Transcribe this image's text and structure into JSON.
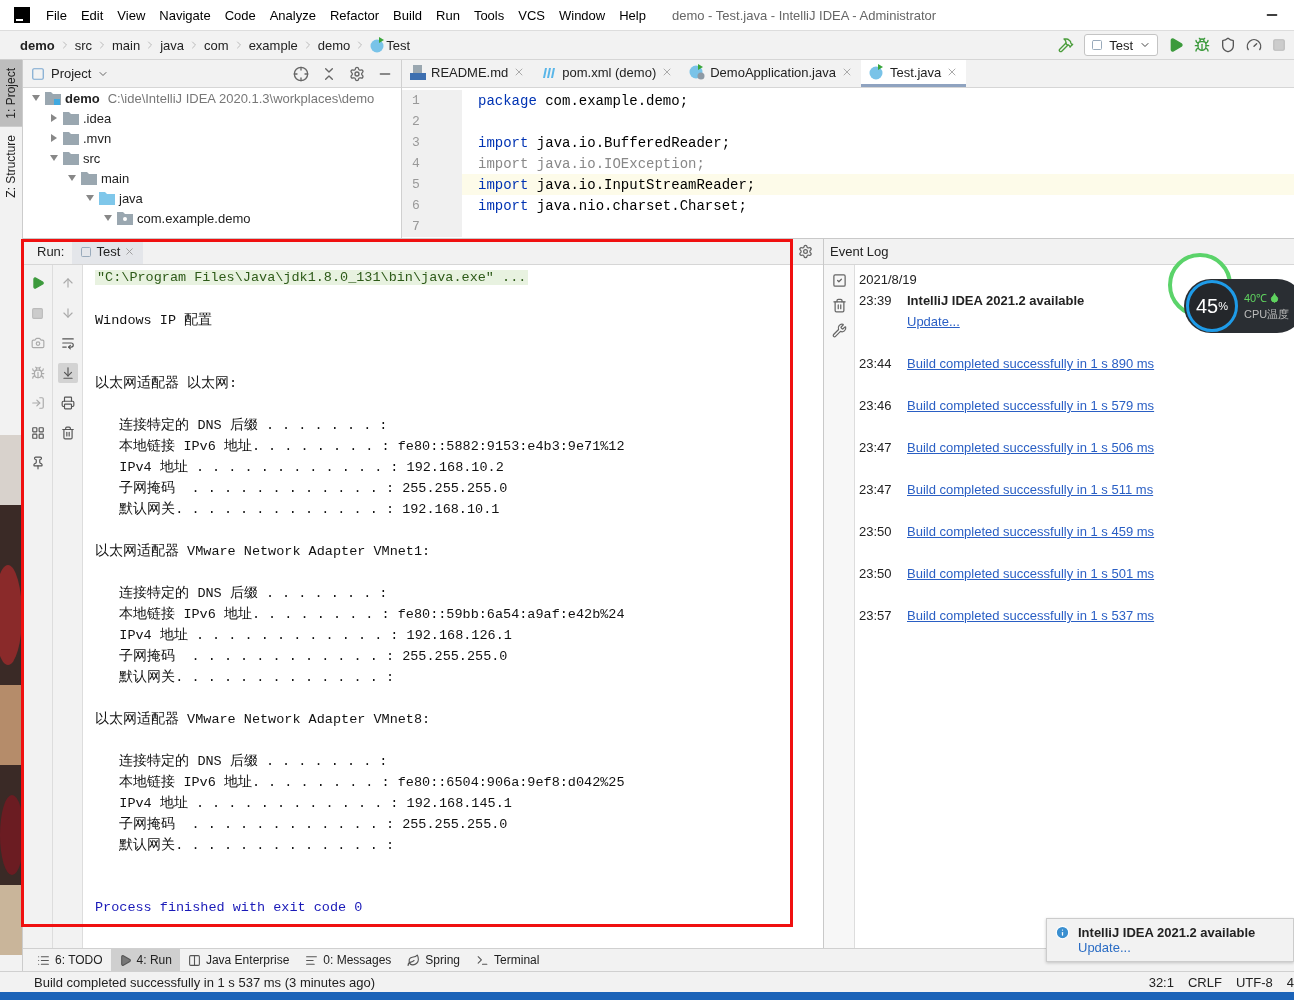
{
  "window": {
    "title": "demo - Test.java - IntelliJ IDEA - Administrator"
  },
  "menu": [
    "File",
    "Edit",
    "View",
    "Navigate",
    "Code",
    "Analyze",
    "Refactor",
    "Build",
    "Run",
    "Tools",
    "VCS",
    "Window",
    "Help"
  ],
  "breadcrumbs": [
    {
      "label": "demo",
      "kind": "project"
    },
    {
      "label": "src",
      "kind": "folder"
    },
    {
      "label": "main",
      "kind": "folder"
    },
    {
      "label": "java",
      "kind": "folder"
    },
    {
      "label": "com",
      "kind": "folder"
    },
    {
      "label": "example",
      "kind": "folder"
    },
    {
      "label": "demo",
      "kind": "folder"
    },
    {
      "label": "Test",
      "kind": "class"
    }
  ],
  "run_config": {
    "label": "Test"
  },
  "side_tabs": [
    {
      "label": "1: Project",
      "selected": true
    },
    {
      "label": "Z: Structure",
      "selected": false
    }
  ],
  "project_panel": {
    "title": "Project",
    "tree": [
      {
        "label": "demo",
        "kind": "module",
        "path": "C:\\ide\\IntelliJ IDEA 2020.1.3\\workplaces\\demo",
        "expanded": true,
        "children": [
          {
            "label": ".idea",
            "kind": "folder",
            "expanded": false
          },
          {
            "label": ".mvn",
            "kind": "folder",
            "expanded": false
          },
          {
            "label": "src",
            "kind": "folder",
            "expanded": true,
            "children": [
              {
                "label": "main",
                "kind": "folder",
                "expanded": true,
                "children": [
                  {
                    "label": "java",
                    "kind": "source",
                    "expanded": true,
                    "children": [
                      {
                        "label": "com.example.demo",
                        "kind": "package",
                        "expanded": true
                      }
                    ]
                  }
                ]
              }
            ]
          }
        ]
      }
    ]
  },
  "editor": {
    "tabs": [
      {
        "label": "README.md",
        "kind": "markdown",
        "selected": false
      },
      {
        "label": "pom.xml (demo)",
        "kind": "maven",
        "selected": false
      },
      {
        "label": "DemoApplication.java",
        "kind": "spring",
        "selected": false
      },
      {
        "label": "Test.java",
        "kind": "class",
        "selected": true
      }
    ],
    "lines": [
      {
        "number": "1",
        "keyword": "package",
        "rest": " com.example.demo;",
        "unused": false,
        "current": false
      },
      {
        "number": "2",
        "current": false
      },
      {
        "number": "3",
        "keyword": "import",
        "rest": " java.io.BufferedReader;",
        "unused": false,
        "current": false
      },
      {
        "number": "4",
        "keyword": "import",
        "rest": " java.io.IOException;",
        "unused": true,
        "current": false
      },
      {
        "number": "5",
        "keyword": "import",
        "rest": " java.io.InputStreamReader;",
        "unused": false,
        "current": true
      },
      {
        "number": "6",
        "keyword": "import",
        "rest": " java.nio.charset.Charset;",
        "unused": false,
        "current": false
      },
      {
        "number": "7",
        "current": false
      }
    ]
  },
  "run_panel": {
    "label": "Run:",
    "tab": "Test",
    "console": [
      {
        "kind": "command",
        "text": "\"C:\\Program Files\\Java\\jdk1.8.0_131\\bin\\java.exe\" ..."
      },
      {
        "kind": "blank"
      },
      {
        "kind": "output",
        "text": "Windows IP 配置"
      },
      {
        "kind": "blank"
      },
      {
        "kind": "blank"
      },
      {
        "kind": "output",
        "text": "以太网适配器 以太网:"
      },
      {
        "kind": "blank"
      },
      {
        "kind": "output",
        "text": "   连接特定的 DNS 后缀 . . . . . . . :"
      },
      {
        "kind": "output",
        "text": "   本地链接 IPv6 地址. . . . . . . . : fe80::5882:9153:e4b3:9e71%12"
      },
      {
        "kind": "output",
        "text": "   IPv4 地址 . . . . . . . . . . . . : 192.168.10.2"
      },
      {
        "kind": "output",
        "text": "   子网掩码  . . . . . . . . . . . . : 255.255.255.0"
      },
      {
        "kind": "output",
        "text": "   默认网关. . . . . . . . . . . . . : 192.168.10.1"
      },
      {
        "kind": "blank"
      },
      {
        "kind": "output",
        "text": "以太网适配器 VMware Network Adapter VMnet1:"
      },
      {
        "kind": "blank"
      },
      {
        "kind": "output",
        "text": "   连接特定的 DNS 后缀 . . . . . . . :"
      },
      {
        "kind": "output",
        "text": "   本地链接 IPv6 地址. . . . . . . . : fe80::59bb:6a54:a9af:e42b%24"
      },
      {
        "kind": "output",
        "text": "   IPv4 地址 . . . . . . . . . . . . : 192.168.126.1"
      },
      {
        "kind": "output",
        "text": "   子网掩码  . . . . . . . . . . . . : 255.255.255.0"
      },
      {
        "kind": "output",
        "text": "   默认网关. . . . . . . . . . . . . :"
      },
      {
        "kind": "blank"
      },
      {
        "kind": "output",
        "text": "以太网适配器 VMware Network Adapter VMnet8:"
      },
      {
        "kind": "blank"
      },
      {
        "kind": "output",
        "text": "   连接特定的 DNS 后缀 . . . . . . . :"
      },
      {
        "kind": "output",
        "text": "   本地链接 IPv6 地址. . . . . . . . : fe80::6504:906a:9ef8:d042%25"
      },
      {
        "kind": "output",
        "text": "   IPv4 地址 . . . . . . . . . . . . : 192.168.145.1"
      },
      {
        "kind": "output",
        "text": "   子网掩码  . . . . . . . . . . . . : 255.255.255.0"
      },
      {
        "kind": "output",
        "text": "   默认网关. . . . . . . . . . . . . :"
      },
      {
        "kind": "blank"
      },
      {
        "kind": "blank"
      },
      {
        "kind": "exit",
        "text": "Process finished with exit code 0"
      }
    ]
  },
  "event_log": {
    "title": "Event Log",
    "date": "2021/8/19",
    "entries": [
      {
        "time": "23:39",
        "kind": "notice",
        "title": "IntelliJ IDEA 2021.2 available",
        "link": "Update..."
      },
      {
        "time": "23:44",
        "kind": "link",
        "link": "Build completed successfully in 1 s 890 ms"
      },
      {
        "time": "23:46",
        "kind": "link",
        "link": "Build completed successfully in 1 s 579 ms"
      },
      {
        "time": "23:47",
        "kind": "link",
        "link": "Build completed successfully in 1 s 506 ms"
      },
      {
        "time": "23:47",
        "kind": "link",
        "link": "Build completed successfully in 1 s 511 ms"
      },
      {
        "time": "23:50",
        "kind": "link",
        "link": "Build completed successfully in 1 s 459 ms"
      },
      {
        "time": "23:50",
        "kind": "link",
        "link": "Build completed successfully in 1 s 501 ms"
      },
      {
        "time": "23:57",
        "kind": "link",
        "link": "Build completed successfully in 1 s 537 ms"
      }
    ]
  },
  "cpu_widget": {
    "value": "45",
    "unit": "%",
    "temperature": "40℃",
    "label": "CPU温度"
  },
  "notification": {
    "title": "IntelliJ IDEA 2021.2 available",
    "link": "Update..."
  },
  "tool_tabs": [
    {
      "label": "6: TODO",
      "kind": "todo",
      "selected": false
    },
    {
      "label": "4: Run",
      "kind": "run",
      "selected": true
    },
    {
      "label": "Java Enterprise",
      "kind": "enterprise",
      "selected": false
    },
    {
      "label": "0: Messages",
      "kind": "messages",
      "selected": false
    },
    {
      "label": "Spring",
      "kind": "spring",
      "selected": false
    },
    {
      "label": "Terminal",
      "kind": "terminal",
      "selected": false
    }
  ],
  "status_bar": {
    "message": "Build completed successfully in 1 s 537 ms (3 minutes ago)",
    "items": [
      "32:1",
      "CRLF",
      "UTF-8",
      "4"
    ]
  }
}
